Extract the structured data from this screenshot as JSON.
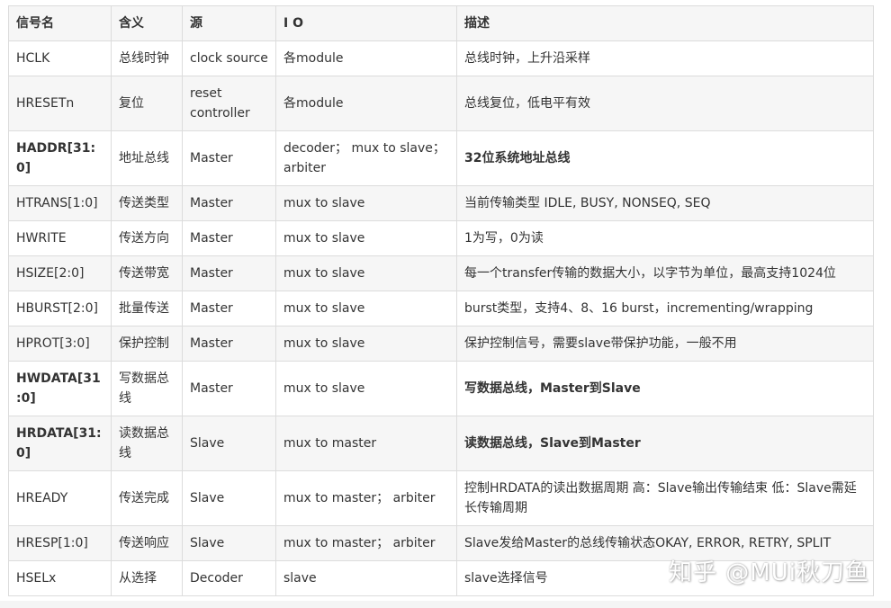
{
  "table": {
    "headers": [
      "信号名",
      "含义",
      "源",
      "I O",
      "描述"
    ],
    "rows": [
      {
        "cells": [
          "HCLK",
          "总线时钟",
          "clock source",
          "各module",
          "总线时钟，上升沿采样"
        ],
        "bold": false,
        "tall": false
      },
      {
        "cells": [
          "HRESETn",
          "复位",
          "reset controller",
          "各module",
          "总线复位，低电平有效"
        ],
        "bold": false,
        "tall": true
      },
      {
        "cells": [
          "HADDR[31:0]",
          "地址总线",
          "Master",
          "decoder； mux to slave；arbiter",
          "32位系统地址总线"
        ],
        "bold": true,
        "tall": true
      },
      {
        "cells": [
          "HTRANS[1:0]",
          "传送类型",
          "Master",
          "mux to slave",
          "当前传输类型 IDLE, BUSY, NONSEQ, SEQ"
        ],
        "bold": false,
        "tall": false
      },
      {
        "cells": [
          "HWRITE",
          "传送方向",
          "Master",
          "mux to slave",
          "1为写，0为读"
        ],
        "bold": false,
        "tall": false
      },
      {
        "cells": [
          "HSIZE[2:0]",
          "传送带宽",
          "Master",
          "mux to slave",
          "每一个transfer传输的数据大小，以字节为单位，最高支持1024位"
        ],
        "bold": false,
        "tall": false
      },
      {
        "cells": [
          "HBURST[2:0]",
          "批量传送",
          "Master",
          "mux to slave",
          "burst类型，支持4、8、16 burst，incrementing/wrapping"
        ],
        "bold": false,
        "tall": false
      },
      {
        "cells": [
          "HPROT[3:0]",
          "保护控制",
          "Master",
          "mux to slave",
          "保护控制信号，需要slave带保护功能，一般不用"
        ],
        "bold": false,
        "tall": false
      },
      {
        "cells": [
          "HWDATA[31:0]",
          "写数据总线",
          "Master",
          "mux to slave",
          "写数据总线，Master到Slave"
        ],
        "bold": true,
        "tall": true
      },
      {
        "cells": [
          "HRDATA[31:0]",
          "读数据总线",
          "Slave",
          "mux to master",
          "读数据总线，Slave到Master"
        ],
        "bold": true,
        "tall": true
      },
      {
        "cells": [
          "HREADY",
          "传送完成",
          "Slave",
          "mux to master； arbiter",
          "控制HRDATA的读出数据周期 高：Slave输出传输结束 低：Slave需延长传输周期"
        ],
        "bold": false,
        "tall": true
      },
      {
        "cells": [
          "HRESP[1:0]",
          "传送响应",
          "Slave",
          "mux to master； arbiter",
          "Slave发给Master的总线传输状态OKAY, ERROR, RETRY, SPLIT"
        ],
        "bold": false,
        "tall": false
      },
      {
        "cells": [
          "HSELx",
          "从选择",
          "Decoder",
          "slave",
          "slave选择信号"
        ],
        "bold": false,
        "tall": false
      }
    ]
  },
  "watermark": "知乎 @MUi秋刀鱼"
}
